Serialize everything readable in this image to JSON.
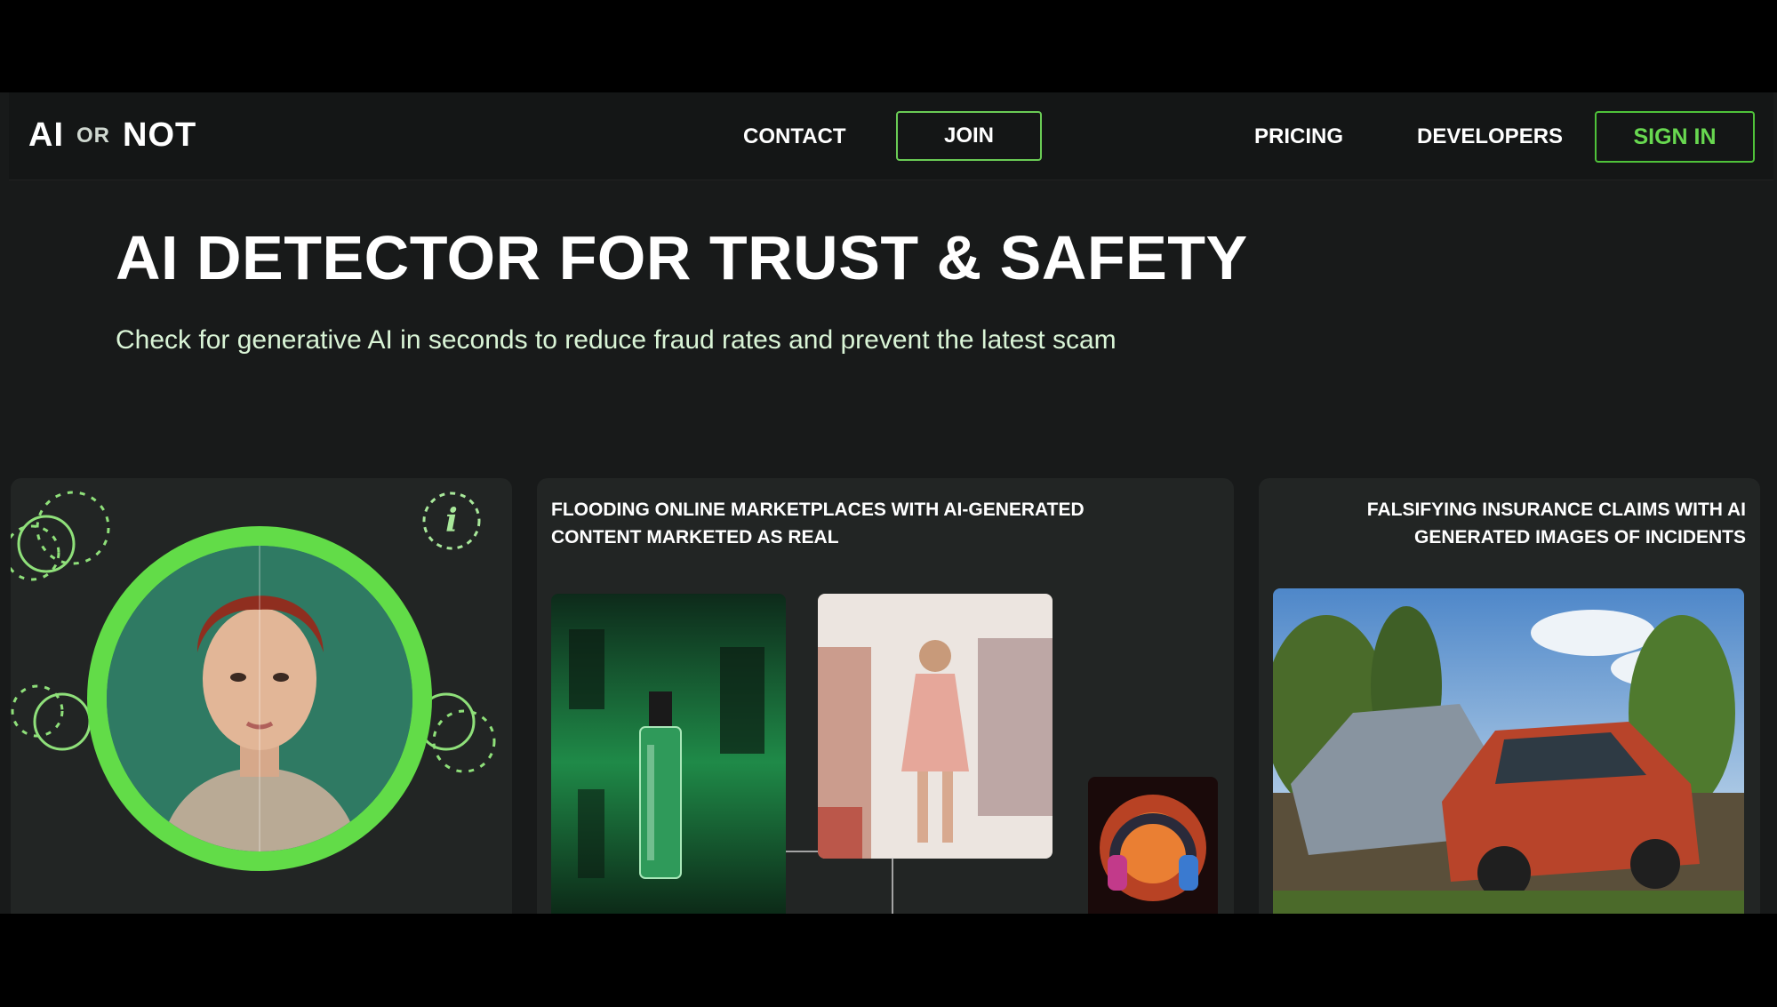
{
  "brand": {
    "logo_left": "AI",
    "logo_or": "OR",
    "logo_right": "NOT"
  },
  "nav": {
    "contact": "CONTACT",
    "join": "JOIN",
    "pricing": "PRICING",
    "developers": "DEVELOPERS",
    "sign_in": "SIGN IN"
  },
  "hero": {
    "title": "AI DETECTOR FOR TRUST & SAFETY",
    "subtitle": "Check for generative AI in seconds to reduce fraud rates and prevent the latest scam"
  },
  "cards": [
    {
      "title": ""
    },
    {
      "title": "FLOODING ONLINE MARKETPLACES WITH AI-GENERATED CONTENT MARKETED AS REAL"
    },
    {
      "title": "FALSIFYING INSURANCE CLAIMS WITH AI GENERATED IMAGES OF INCIDENTS"
    }
  ],
  "icons": {
    "info": "info-icon",
    "decor_circles": "dashed-circle-icon"
  },
  "colors": {
    "accent": "#62dc48",
    "signin_text": "#68d850",
    "background": "#181a1a",
    "card": "#222524"
  }
}
